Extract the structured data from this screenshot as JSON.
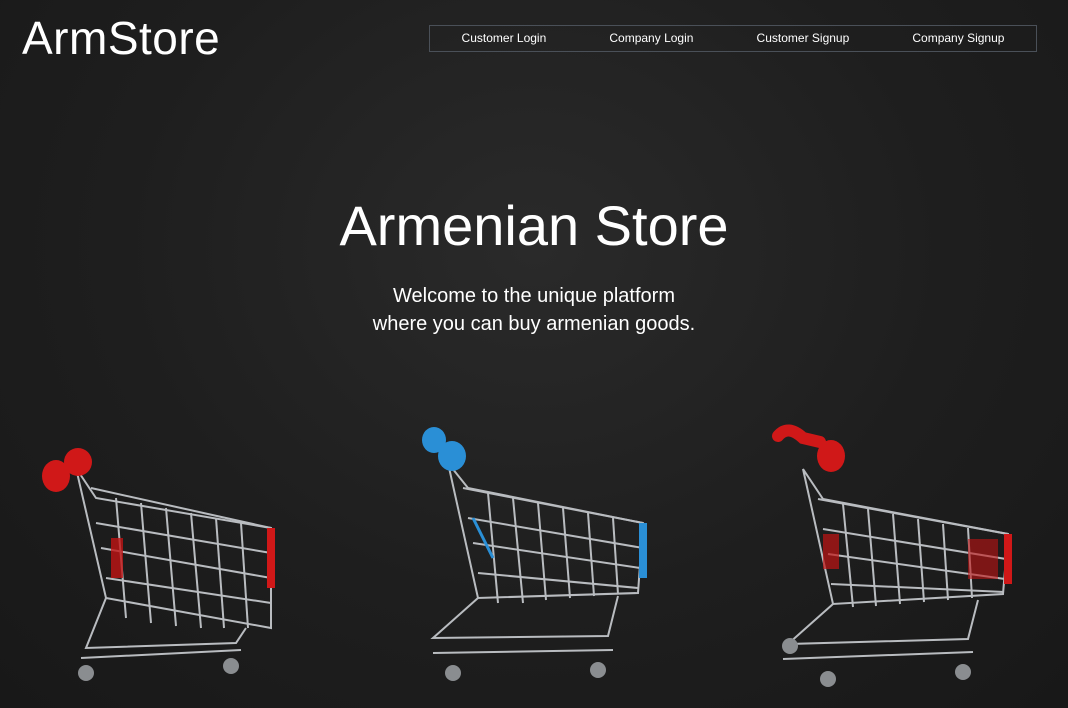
{
  "header": {
    "logo": "ArmStore",
    "nav": [
      {
        "label": "Customer Login"
      },
      {
        "label": "Company Login"
      },
      {
        "label": "Customer Signup"
      },
      {
        "label": "Company Signup"
      }
    ]
  },
  "hero": {
    "title": "Armenian Store",
    "subtitle_line1": "Welcome to the unique platform",
    "subtitle_line2": "where you can buy armenian goods."
  },
  "colors": {
    "background": "#1f1f1f",
    "cart_red": "#d01818",
    "cart_blue": "#2a8fd6",
    "cart_metal": "#b9bcc0"
  },
  "image": {
    "subject": "shopping-carts",
    "carts": [
      {
        "handle_color": "red"
      },
      {
        "handle_color": "blue"
      },
      {
        "handle_color": "red"
      }
    ]
  }
}
